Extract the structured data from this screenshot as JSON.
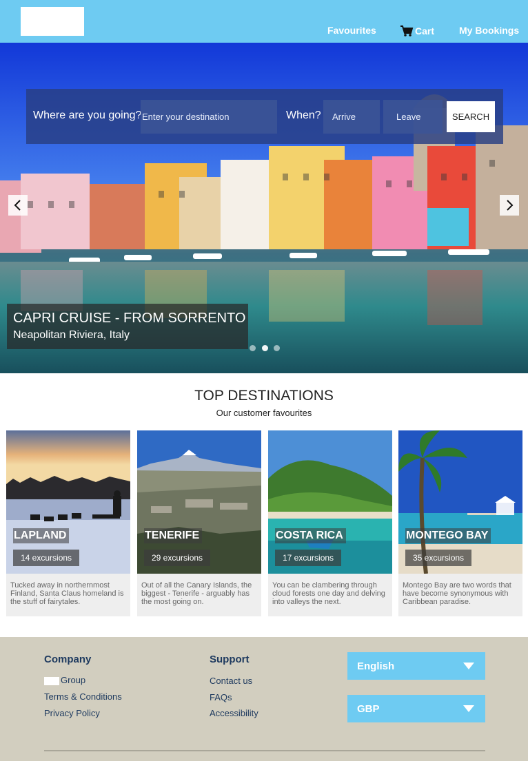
{
  "header": {
    "favourites": "Favourites",
    "cart": "Cart",
    "bookings": "My Bookings"
  },
  "search": {
    "question": "Where are you going?",
    "destination_placeholder": "Enter your destination",
    "when": "When?",
    "arrive": "Arrive",
    "leave": "Leave",
    "button": "SEARCH"
  },
  "hero": {
    "title": "CAPRI CRUISE - FROM SORRENTO",
    "subtitle": "Neapolitan Riviera, Italy",
    "slides": 3,
    "active_slide": 1
  },
  "destinations": {
    "title": "TOP DESTINATIONS",
    "subtitle": "Our customer favourites",
    "cards": [
      {
        "name": "LAPLAND",
        "count": "14 excursions",
        "desc": "Tucked away in northernmost Finland, Santa Claus homeland is the stuff of fairytales."
      },
      {
        "name": "TENERIFE",
        "count": "29 excursions",
        "desc": "Out of all the Canary Islands, the biggest - Tenerife - arguably has the most going on."
      },
      {
        "name": "COSTA RICA",
        "count": "17 excursions",
        "desc": "You can be clambering through cloud forests one day and delving into valleys the next."
      },
      {
        "name": "MONTEGO BAY",
        "count": "35 excursions",
        "desc": "Montego Bay are two words that have become synonymous with Caribbean paradise."
      }
    ]
  },
  "footer": {
    "company": {
      "heading": "Company",
      "links": [
        "Group",
        "Terms & Conditions",
        "Privacy Policy"
      ]
    },
    "support": {
      "heading": "Support",
      "links": [
        "Contact us",
        "FAQs",
        "Accessibility"
      ]
    },
    "language": "English",
    "currency": "GBP"
  },
  "colors": {
    "header_bg": "#6ecbf2",
    "footer_bg": "#d2cebf",
    "footer_text": "#1e3a5f"
  }
}
